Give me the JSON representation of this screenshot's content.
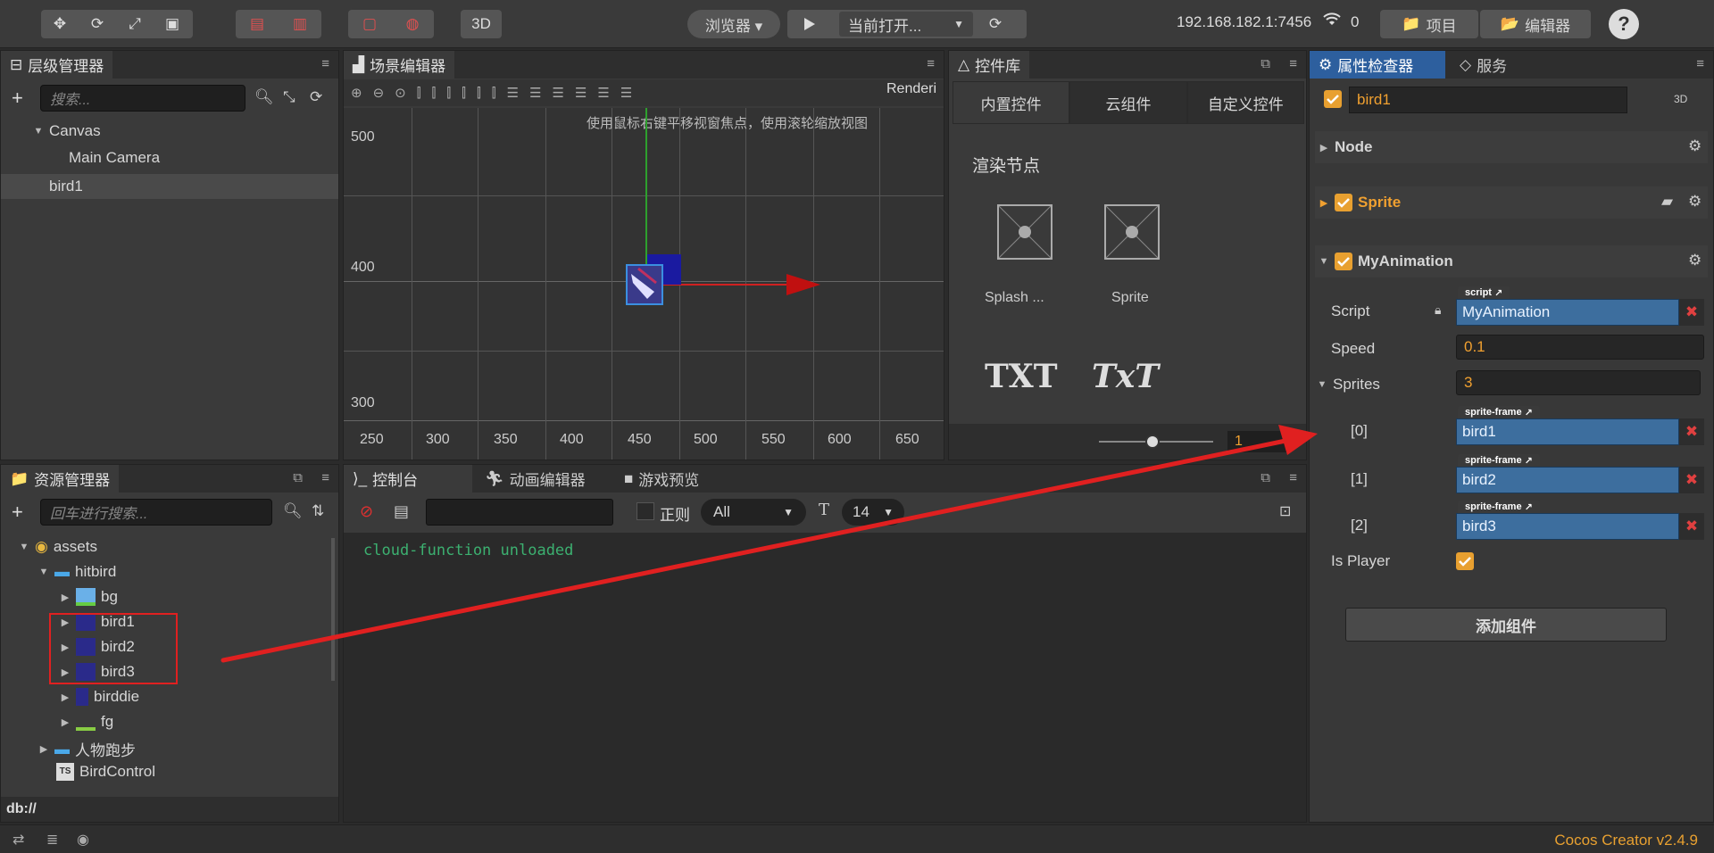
{
  "toolbar": {
    "browser_label": "浏览器 ▾",
    "scene_select": "当前打开...",
    "ip_address": "192.168.182.1:7456",
    "wifi_count": "0",
    "project_button": "项目",
    "editor_button": "编辑器",
    "mode_3d": "3D"
  },
  "hierarchy": {
    "title": "层级管理器",
    "search_placeholder": "搜索...",
    "items": [
      {
        "label": "Canvas"
      },
      {
        "label": "Main Camera"
      },
      {
        "label": "bird1"
      }
    ]
  },
  "scene": {
    "title": "场景编辑器",
    "hint": "使用鼠标右键平移视窗焦点，使用滚轮缩放视图",
    "render_label": "Renderi",
    "y_labels": [
      "500",
      "400",
      "300"
    ],
    "x_labels": [
      "250",
      "300",
      "350",
      "400",
      "450",
      "500",
      "550",
      "600",
      "650"
    ]
  },
  "widgets": {
    "title": "控件库",
    "tabs": [
      "内置控件",
      "云组件",
      "自定义控件"
    ],
    "section": "渲染节点",
    "items": [
      "Splash ...",
      "Sprite"
    ],
    "txt_items": [
      "TXT",
      "TxT"
    ],
    "zoom_value": "1"
  },
  "assets": {
    "title": "资源管理器",
    "search_placeholder": "回车进行搜索...",
    "tree": [
      "assets",
      "hitbird",
      "bg",
      "bird1",
      "bird2",
      "bird3",
      "birddie",
      "fg",
      "人物跑步",
      "BirdControl"
    ],
    "path": "db://"
  },
  "console": {
    "tabs": [
      "控制台",
      "动画编辑器",
      "游戏预览"
    ],
    "regex_label": "正则",
    "level_select": "All",
    "font_size": "14",
    "log_line": "cloud-function unloaded"
  },
  "inspector": {
    "tabs": [
      "属性检查器",
      "服务"
    ],
    "node_name": "bird1",
    "badge_3d": "3D",
    "sections": {
      "node": "Node",
      "sprite": "Sprite",
      "my_animation": "MyAnimation"
    },
    "script_tag": "script",
    "script_label": "Script",
    "script_value": "MyAnimation",
    "speed_label": "Speed",
    "speed_value": "0.1",
    "sprites_label": "Sprites",
    "sprites_count": "3",
    "frame_tag": "sprite-frame",
    "frames": [
      {
        "index": "[0]",
        "value": "bird1"
      },
      {
        "index": "[1]",
        "value": "bird2"
      },
      {
        "index": "[2]",
        "value": "bird3"
      }
    ],
    "is_player_label": "Is Player",
    "add_component": "添加组件"
  },
  "footer": {
    "version": "Cocos Creator v2.4.9"
  },
  "colors": {
    "accent": "#e8a030",
    "selection_blue": "#3d6e9e",
    "annotation_red": "#e02020"
  }
}
